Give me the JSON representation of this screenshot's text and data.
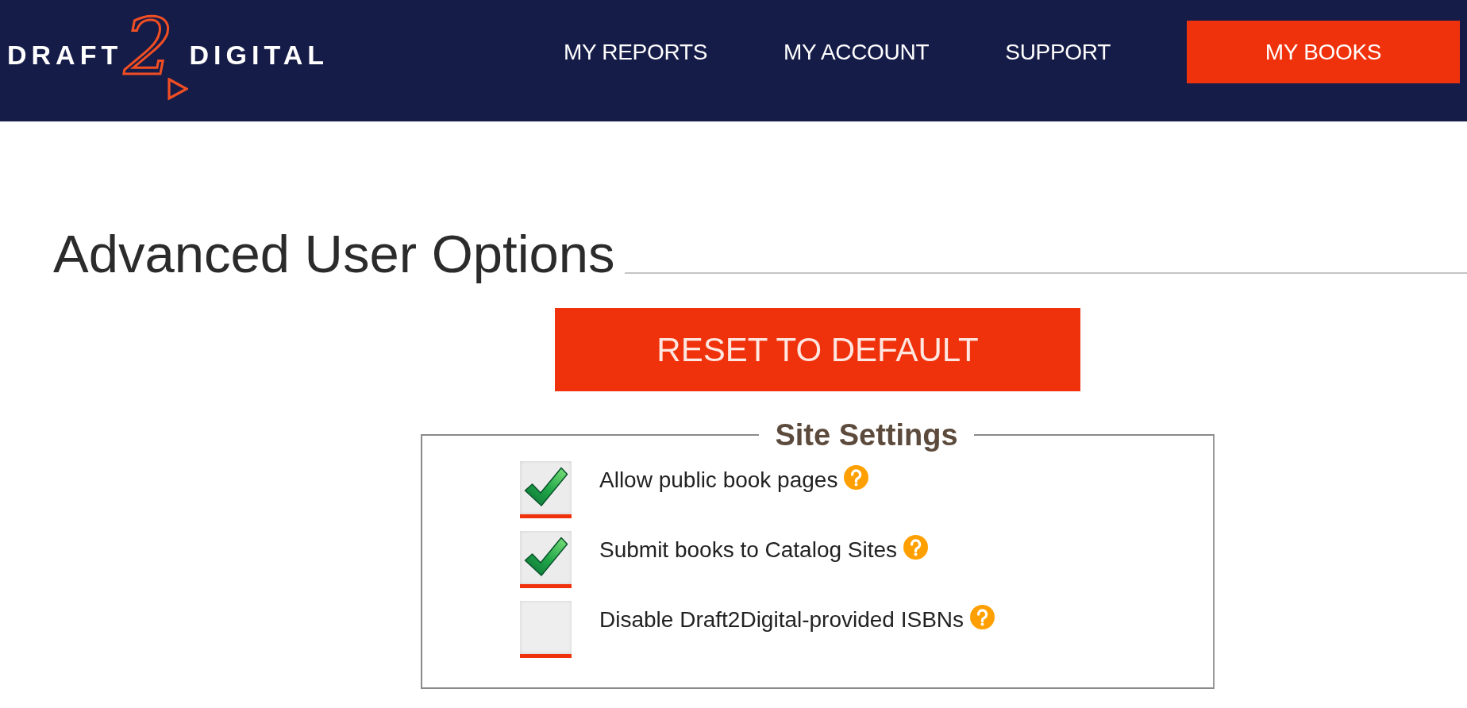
{
  "header": {
    "logo": {
      "word_left": "DRAFT",
      "numeral": "2",
      "word_right": "DIGITAL"
    },
    "nav": [
      {
        "label": "MY REPORTS",
        "kind": "link"
      },
      {
        "label": "MY ACCOUNT",
        "kind": "link"
      },
      {
        "label": "SUPPORT",
        "kind": "link"
      },
      {
        "label": "MY BOOKS",
        "kind": "button"
      }
    ]
  },
  "page": {
    "title": "Advanced User Options",
    "reset_button": "RESET TO DEFAULT"
  },
  "site_settings": {
    "legend": "Site Settings",
    "options": [
      {
        "label": "Allow public book pages",
        "checked": true
      },
      {
        "label": "Submit books to Catalog Sites",
        "checked": true
      },
      {
        "label": "Disable Draft2Digital-provided ISBNs",
        "checked": false
      }
    ]
  }
}
